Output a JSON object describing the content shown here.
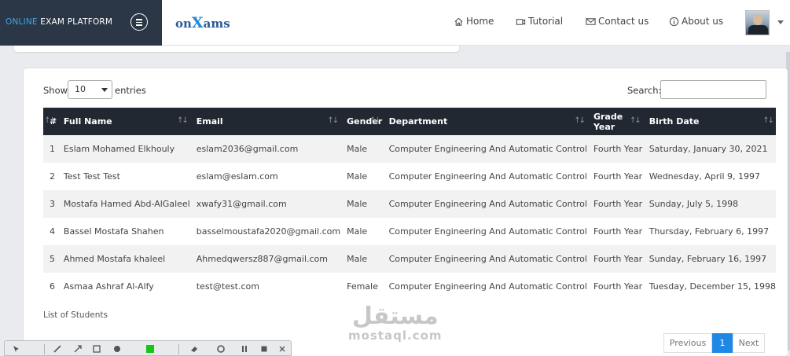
{
  "header": {
    "brand_accent": "ONLINE",
    "brand_rest": " EXAM PLATFORM",
    "logo_prefix": "on",
    "logo_x": "X",
    "logo_suffix": "ams",
    "nav": [
      {
        "label": "Home",
        "icon": "home-icon"
      },
      {
        "label": "Tutorial",
        "icon": "video-icon"
      },
      {
        "label": "Contact us",
        "icon": "envelope-icon"
      },
      {
        "label": "About us",
        "icon": "info-icon"
      }
    ]
  },
  "table_controls": {
    "show_label": "Show",
    "entries_value": "10",
    "entries_label": "entries",
    "search_label": "Search:"
  },
  "table": {
    "columns": [
      "#",
      "Full Name",
      "Email",
      "Gender",
      "Department",
      "Grade Year",
      "Birth Date"
    ],
    "rows": [
      [
        "1",
        "Eslam Mohamed Elkhouly",
        "eslam2036@gmail.com",
        "Male",
        "Computer Engineering And Automatic Control",
        "Fourth Year",
        "Saturday, January 30, 2021"
      ],
      [
        "2",
        "Test Test Test",
        "eslam@eslam.com",
        "Male",
        "Computer Engineering And Automatic Control",
        "Fourth Year",
        "Wednesday, April 9, 1997"
      ],
      [
        "3",
        "Mostafa Hamed Abd-AlGaleel",
        "xwafy31@gmail.com",
        "Male",
        "Computer Engineering And Automatic Control",
        "Fourth Year",
        "Sunday, July 5, 1998"
      ],
      [
        "4",
        "Bassel Mostafa Shahen",
        "basselmoustafa2020@gmail.com",
        "Male",
        "Computer Engineering And Automatic Control",
        "Fourth Year",
        "Thursday, February 6, 1997"
      ],
      [
        "5",
        "Ahmed Mostafa khaleel",
        "Ahmedqwersz887@gmail.com",
        "Male",
        "Computer Engineering And Automatic Control",
        "Fourth Year",
        "Sunday, February 16, 1997"
      ],
      [
        "6",
        "Asmaa Ashraf Al-Alfy",
        "test@test.com",
        "Female",
        "Computer Engineering And Automatic Control",
        "Fourth Year",
        "Tuesday, December 15, 1998"
      ]
    ],
    "caption": "List of Students"
  },
  "pagination": {
    "previous": "Previous",
    "current": "1",
    "next": "Next"
  },
  "watermark": {
    "arabic": "مستقل",
    "latin": "mostaql.com"
  },
  "colors": {
    "sidebar": "#2b3646",
    "accent": "#39a9e0",
    "table_header": "#222831",
    "page_active": "#1e88e5"
  }
}
